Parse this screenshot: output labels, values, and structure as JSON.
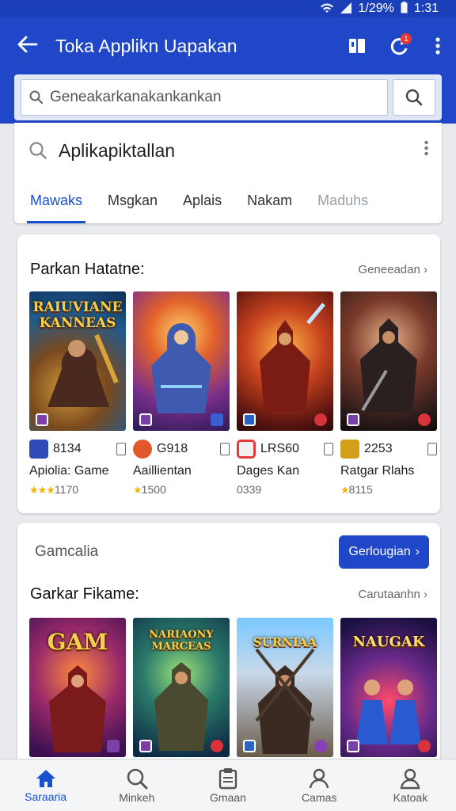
{
  "status_bar": {
    "battery": "1/29%",
    "time": "1:31"
  },
  "app_bar": {
    "title": "Toka Applikn Uapakan",
    "badge": "1"
  },
  "search": {
    "value": "Geneakarkanakankankan"
  },
  "query_card": {
    "query": "Aplikapiktallan",
    "tabs": [
      {
        "label": "Mawaks",
        "active": true
      },
      {
        "label": "Msgkan"
      },
      {
        "label": "Aplais"
      },
      {
        "label": "Nakam"
      },
      {
        "label": "Maduhs",
        "dim": true
      }
    ]
  },
  "section1": {
    "heading": "Parkan Hatatne:",
    "link": "Geneeadan",
    "items": [
      {
        "banner": "RAIUVIANE KANNEAS",
        "count": "8134",
        "name": "Apiolia: Game",
        "rating": "1170"
      },
      {
        "count": "G918",
        "name": "Aaillientan",
        "rating": "1500"
      },
      {
        "count": "LRS60",
        "name": "Dages Kan",
        "rating": "0339"
      },
      {
        "count": "2253",
        "name": "Ratgar Rlahs",
        "rating": "8115"
      }
    ]
  },
  "section2": {
    "label": "Gamcalia",
    "button": "Gerlougian",
    "heading": "Garkar Fikame:",
    "link": "Carutaanhn",
    "items": [
      {
        "banner": "GAM"
      },
      {
        "banner": "NARIAONY MARCEAS"
      },
      {
        "banner": "SURNIAA"
      },
      {
        "banner": "NAUGAK"
      }
    ]
  },
  "bottom_nav": [
    {
      "label": "Saraaria",
      "icon": "home-icon",
      "active": true
    },
    {
      "label": "Minkeh",
      "icon": "search-icon"
    },
    {
      "label": "Gmaan",
      "icon": "clipboard-icon"
    },
    {
      "label": "Camas",
      "icon": "person-icon"
    },
    {
      "label": "Katoak",
      "icon": "account-icon"
    }
  ],
  "colors": {
    "primary": "#1f47c8",
    "accent": "#1a4fd0",
    "star": "#f2b400"
  }
}
